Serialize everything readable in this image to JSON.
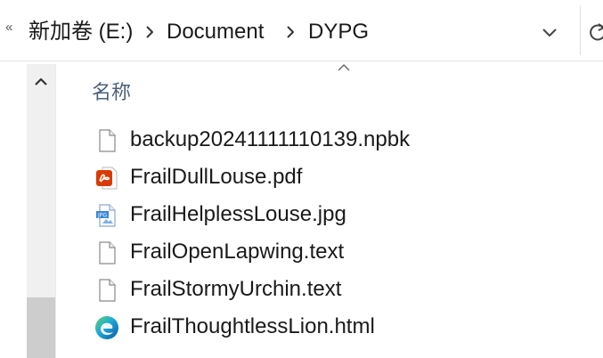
{
  "address_bar": {
    "overflow_glyph": "«",
    "breadcrumbs": [
      {
        "label": "新加卷 (E:)"
      },
      {
        "label": "Document"
      },
      {
        "label": "DYPG"
      }
    ]
  },
  "column_header": {
    "name_label": "名称"
  },
  "files": [
    {
      "name": "backup20241111110139.npbk",
      "icon": "generic-file-icon"
    },
    {
      "name": "FrailDullLouse.pdf",
      "icon": "pdf-file-icon"
    },
    {
      "name": "FrailHelplessLouse.jpg",
      "icon": "jpg-file-icon"
    },
    {
      "name": "FrailOpenLapwing.text",
      "icon": "generic-file-icon"
    },
    {
      "name": "FrailStormyUrchin.text",
      "icon": "generic-file-icon"
    },
    {
      "name": "FrailThoughtlessLion.html",
      "icon": "edge-browser-icon"
    }
  ],
  "colors": {
    "column_header_text": "#4c607a",
    "pdf_red": "#d83b01",
    "jpg_blue": "#3a87d6",
    "edge_blue": "#0c59a4",
    "edge_green": "#5fd66b"
  }
}
